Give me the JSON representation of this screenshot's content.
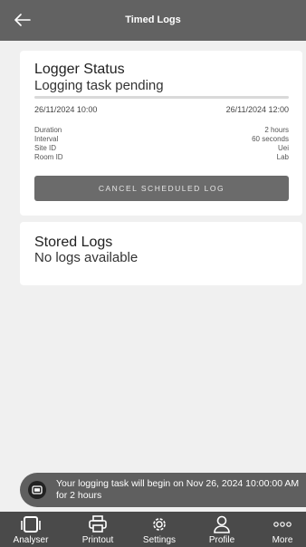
{
  "appbar": {
    "title": "Timed Logs",
    "back_icon": "back-arrow-icon"
  },
  "status_card": {
    "title": "Logger Status",
    "subtitle": "Logging task pending",
    "progress_fraction": 0,
    "start_date": "26/11/2024 10:00",
    "end_date": "26/11/2024 12:00",
    "details": [
      {
        "label": "Duration",
        "value": "2 hours"
      },
      {
        "label": "Interval",
        "value": "60 seconds"
      },
      {
        "label": "Site ID",
        "value": "Uei"
      },
      {
        "label": "Room ID",
        "value": "Lab"
      }
    ],
    "cancel_label": "CANCEL SCHEDULED LOG"
  },
  "logs_card": {
    "title": "Stored Logs",
    "empty_text": "No logs available"
  },
  "toast": {
    "text": "Your logging task will begin on Nov 26, 2024 10:00:00 AM for 2 hours",
    "icon": "logger-icon"
  },
  "navbar": {
    "items": [
      {
        "label": "Analyser",
        "icon": "analyser-icon"
      },
      {
        "label": "Printout",
        "icon": "printer-icon"
      },
      {
        "label": "Settings",
        "icon": "gear-icon"
      },
      {
        "label": "Profile",
        "icon": "profile-icon"
      },
      {
        "label": "More",
        "icon": "more-icon"
      }
    ]
  },
  "colors": {
    "appbar": "#626262",
    "navbar": "#4a4a4a",
    "toast": "#5f5f5f",
    "button": "#6b6b6b"
  }
}
